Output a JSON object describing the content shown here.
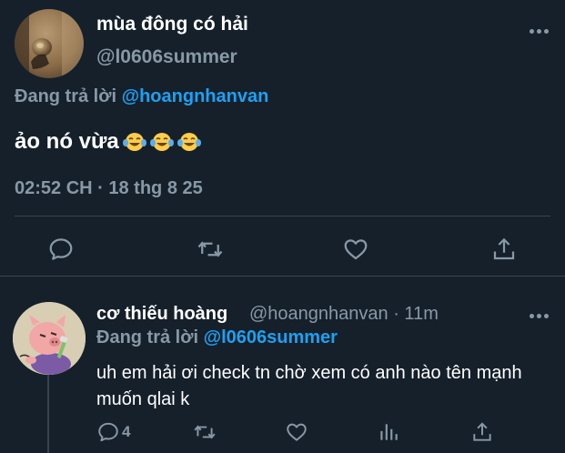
{
  "main_tweet": {
    "display_name": "mùa đông có hải",
    "handle": "@l0606summer",
    "replying_prefix": "Đang trả lời",
    "replying_to": "@hoangnhanvan",
    "text": "ảo nó vừa",
    "emoji": [
      "face-with-tears-of-joy",
      "face-with-tears-of-joy",
      "face-with-tears-of-joy"
    ],
    "timestamp": "02:52 CH · 18 thg 8 25",
    "actions": [
      "reply",
      "retweet",
      "like",
      "share"
    ]
  },
  "reply_tweet": {
    "display_name": "cơ thiếu hoàng",
    "handle_and_time": "@hoangnhanvan · 11m",
    "replying_prefix": "Đang trả lời",
    "replying_to": "@l0606summer",
    "text": "uh em hải ơi check tn chờ xem có anh nào tên mạnh muốn qlai k",
    "reply_count": "4",
    "actions": [
      "reply",
      "retweet",
      "like",
      "analytics",
      "share"
    ]
  },
  "colors": {
    "background": "#15202b",
    "primary_text": "#ffffff",
    "secondary_text": "#8899a6",
    "accent": "#1da1f2",
    "divider": "#38444d"
  }
}
